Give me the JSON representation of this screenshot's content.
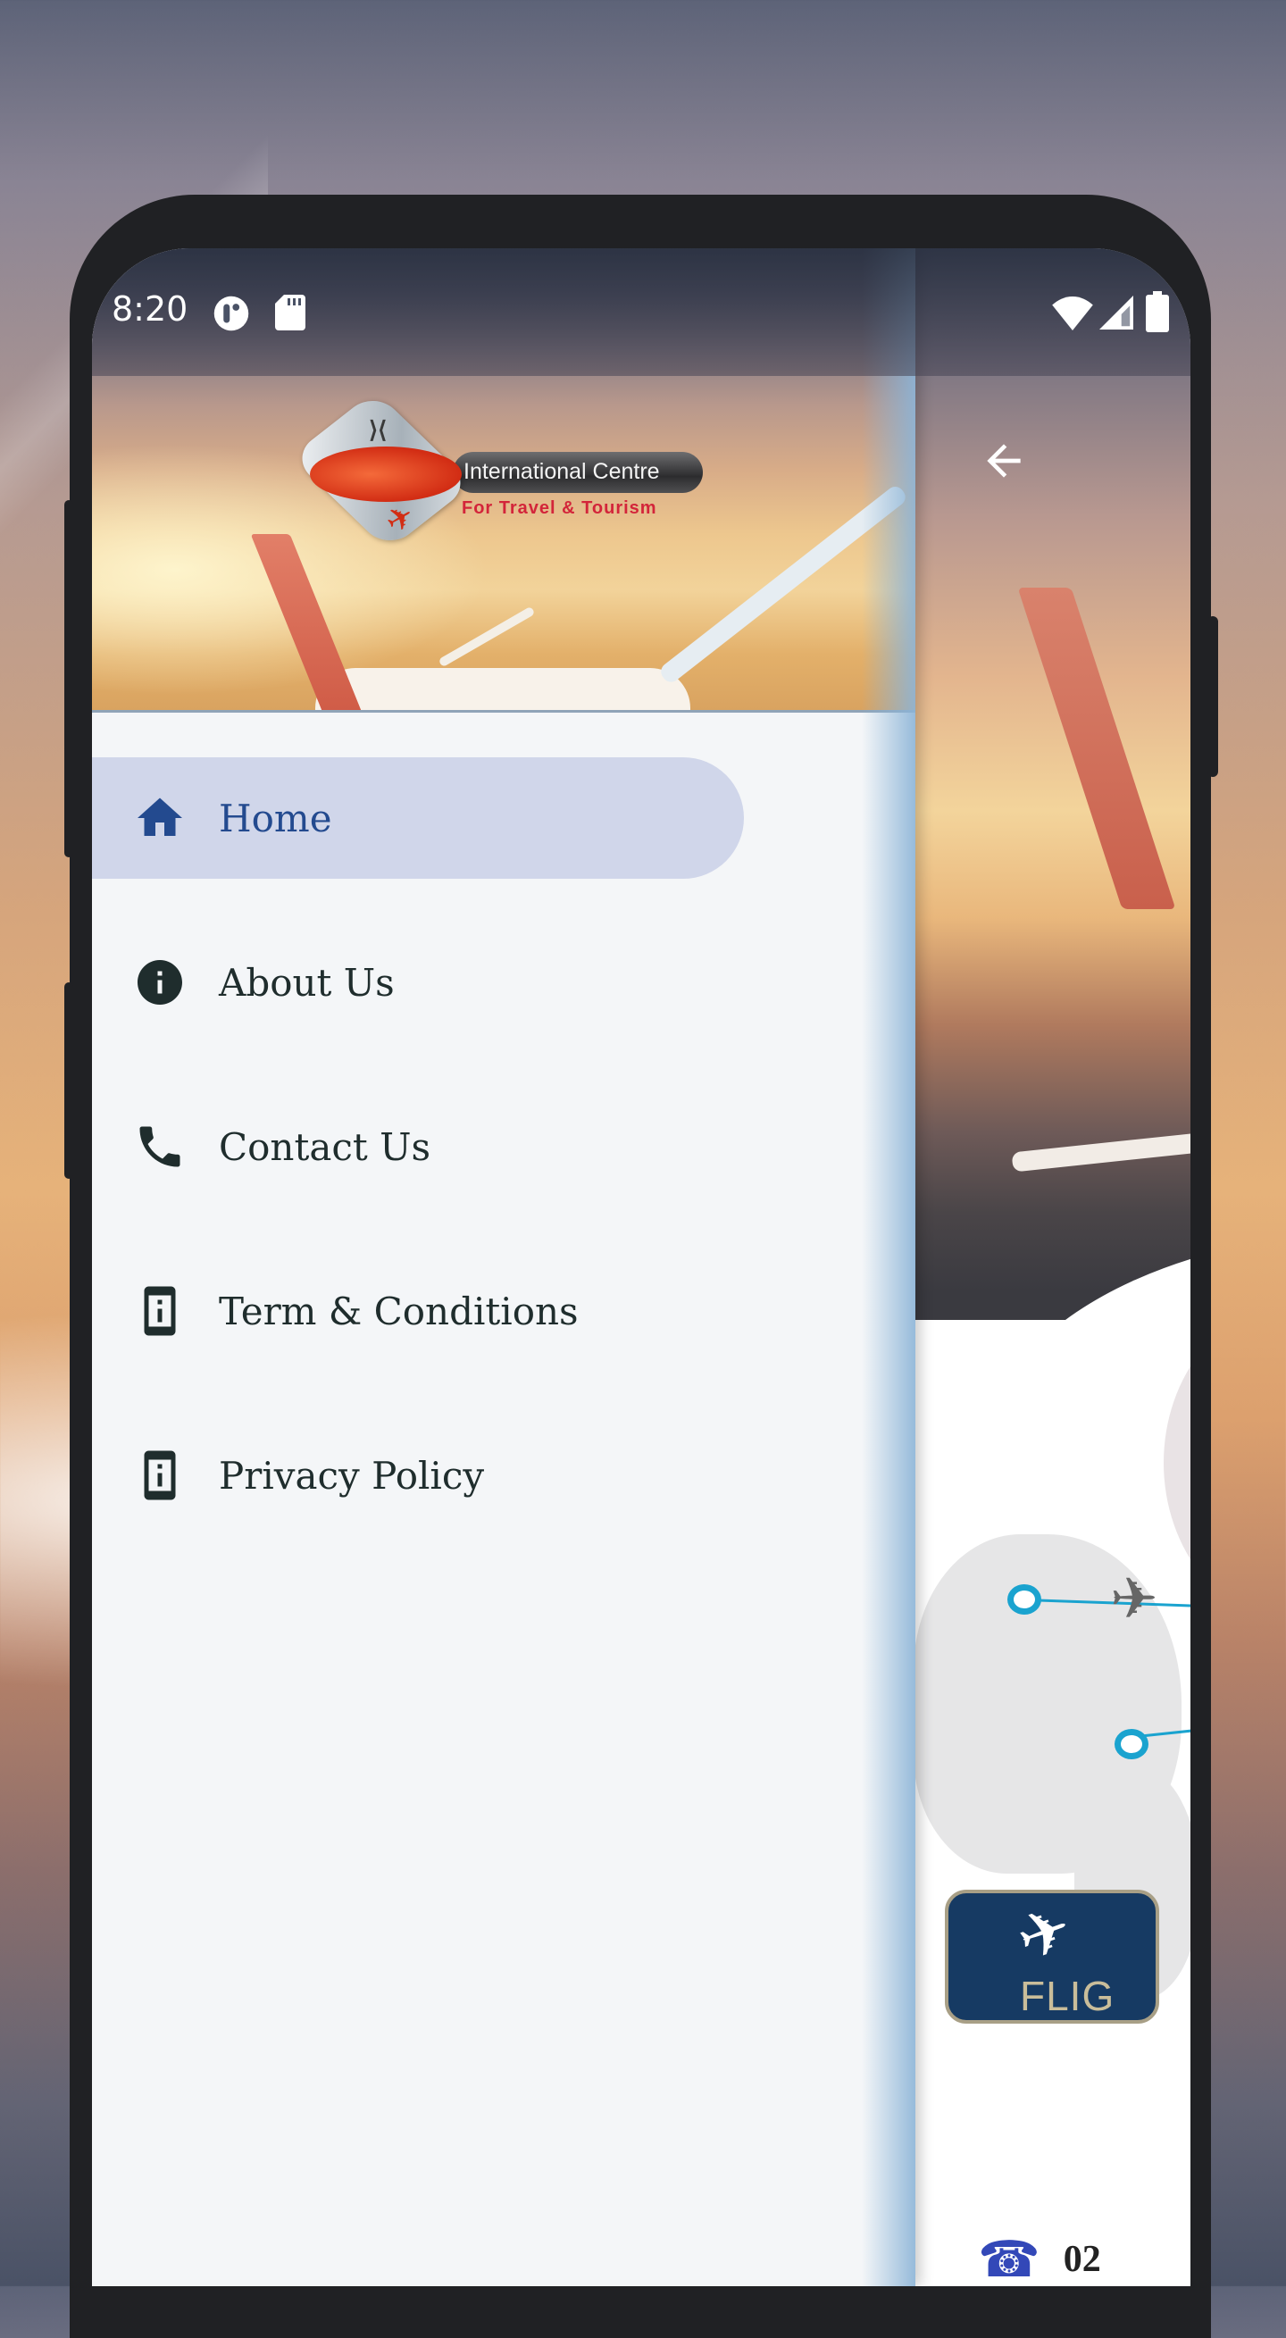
{
  "status_bar": {
    "time": "8:20",
    "left_icons": [
      "notification-app-icon",
      "sd-card-icon"
    ],
    "right_icons": [
      "wifi-icon",
      "cell-signal-icon",
      "battery-icon"
    ]
  },
  "drawer": {
    "logo": {
      "name": "International Centre",
      "subtitle": "For Travel & Tourism"
    },
    "menu": [
      {
        "label": "Home",
        "icon": "home-icon",
        "active": true
      },
      {
        "label": "About Us",
        "icon": "info-icon",
        "active": false
      },
      {
        "label": "Contact Us",
        "icon": "phone-icon",
        "active": false
      },
      {
        "label": "Term & Conditions",
        "icon": "device-info-icon",
        "active": false
      },
      {
        "label": "Privacy Policy",
        "icon": "device-info-icon",
        "active": false
      }
    ]
  },
  "app": {
    "back_icon": "arrow-back-icon",
    "flight_button_label": "FLIG",
    "phone_number_partial": "02"
  },
  "colors": {
    "active_item_bg": "#d0d6ea",
    "active_item_text": "#234a8f",
    "menu_text": "#1f2d2d",
    "drawer_bg": "#f4f6f8",
    "flight_button_bg": "#163a63",
    "route_color": "#1aa3cf",
    "phone_icon_color": "#3348b8"
  }
}
